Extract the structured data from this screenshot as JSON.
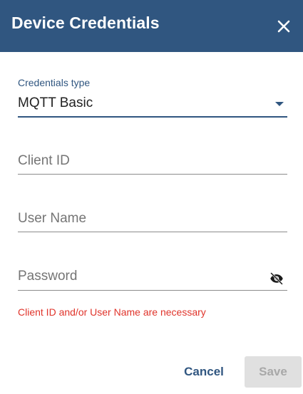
{
  "dialog": {
    "title": "Device Credentials",
    "close_icon": "close-icon"
  },
  "credentials_type": {
    "label": "Credentials type",
    "value": "MQTT Basic",
    "icon": "chevron-down-icon"
  },
  "fields": {
    "client_id": {
      "placeholder": "Client ID",
      "value": ""
    },
    "user_name": {
      "placeholder": "User Name",
      "value": ""
    },
    "password": {
      "placeholder": "Password",
      "value": "",
      "toggle_icon": "eye-off-icon"
    }
  },
  "error_message": "Client ID and/or User Name are necessary",
  "actions": {
    "cancel_label": "Cancel",
    "save_label": "Save"
  },
  "colors": {
    "header": "#305680",
    "accent": "#305680",
    "error": "#e0342b",
    "disabled_bg": "#e0e0e0"
  }
}
